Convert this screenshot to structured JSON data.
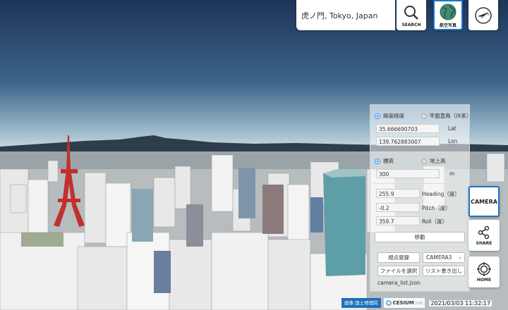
{
  "search": {
    "value": "虎ノ門, Tokyo, Japan",
    "label": "SEARCH"
  },
  "toolbar": {
    "aerial_label": "航空写真",
    "compass": "compass"
  },
  "panel": {
    "coord_mode": {
      "option1": "緯度経度",
      "option2": "平面直角（IX系）",
      "selected": "緯度経度"
    },
    "lat": {
      "value": "35.666690703",
      "unit": "Lat"
    },
    "lon": {
      "value": "139.762883007",
      "unit": "Lon"
    },
    "height_mode": {
      "option1": "標高",
      "option2": "地上高",
      "selected": "標高"
    },
    "height": {
      "value": "300",
      "unit": "m"
    },
    "heading": {
      "value": "255.9",
      "unit": "Heading（度）"
    },
    "pitch": {
      "value": "-0.2",
      "unit": "Pitch（度）"
    },
    "roll": {
      "value": "359.7",
      "unit": "Roll（度）"
    },
    "move_label": "移動",
    "register_label": "視点登録",
    "camera_select": "CAMERA3",
    "file_select_label": "ファイルを選択",
    "list_export_label": "リスト書き出し",
    "file_name": "camera_list.json"
  },
  "side": {
    "camera": "CAMERA",
    "share": "SHARE",
    "home": "HOME"
  },
  "footer": {
    "attribution": "画像 国土地理院",
    "cesium": "CESIUM",
    "cesium_suffix": "ion",
    "datetime": "2021/03/03 11:32:17"
  }
}
